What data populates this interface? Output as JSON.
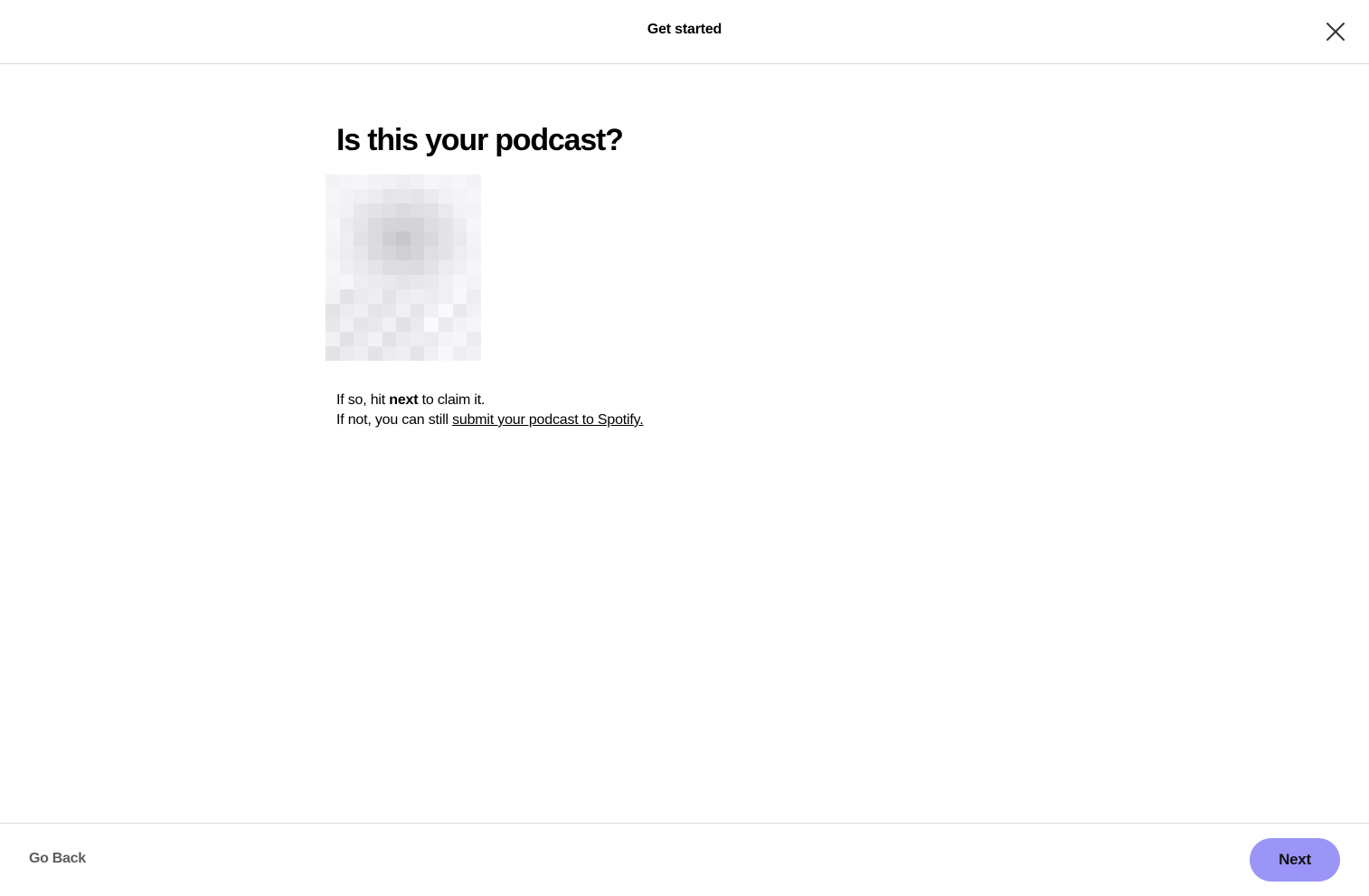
{
  "header": {
    "title": "Get started",
    "close_icon": "close-icon"
  },
  "main": {
    "title": "Is this your podcast?",
    "cover_art": "pixelated podcast cover image",
    "line1": {
      "prefix": "If so, hit ",
      "bold": "next",
      "suffix": " to claim it."
    },
    "line2": {
      "prefix": "If not, you can still ",
      "link": "submit your podcast to Spotify."
    }
  },
  "footer": {
    "back_label": "Go Back",
    "next_label": "Next"
  },
  "colors": {
    "accent": "#9b95f7",
    "border": "#dcdcdc",
    "muted_text": "#5c5c5c"
  }
}
